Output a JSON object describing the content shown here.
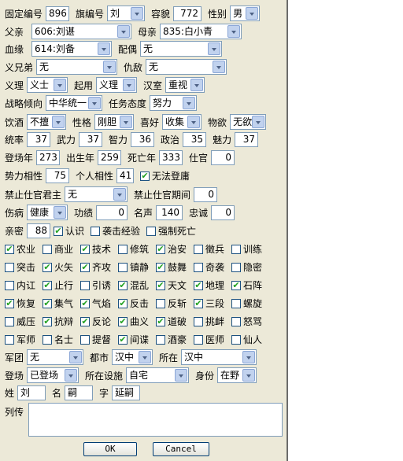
{
  "row1": {
    "fixed_id_label": "固定编号",
    "fixed_id": "896",
    "flag_label": "旗编号",
    "flag": "刘",
    "face_label": "容貌",
    "face": "772",
    "gender_label": "性别",
    "gender": "男"
  },
  "row2": {
    "father_label": "父亲",
    "father": "606:刘谌",
    "mother_label": "母亲",
    "mother": "835:白小青"
  },
  "row3": {
    "blood_label": "血缘",
    "blood": "614:刘备",
    "spouse_label": "配偶",
    "spouse": "无"
  },
  "row4": {
    "sworn_label": "义兄弟",
    "sworn": "无",
    "enemy_label": "仇敌",
    "enemy": "无"
  },
  "row5": {
    "righteous_label": "义理",
    "righteous": "义士",
    "employ_label": "起用",
    "employ": "义理",
    "han_label": "汉室",
    "han": "重视"
  },
  "row6": {
    "strategy_label": "战略倾向",
    "strategy": "中华统一",
    "mission_label": "任务态度",
    "mission": "努力"
  },
  "row7": {
    "drink_label": "饮酒",
    "drink": "不擅",
    "personality_label": "性格",
    "personality": "刚胆",
    "hobby_label": "喜好",
    "hobby": "收集",
    "desire_label": "物欲",
    "desire": "无欲"
  },
  "row8": {
    "lead_label": "统率",
    "lead": "37",
    "war_label": "武力",
    "war": "37",
    "int_label": "智力",
    "int": "36",
    "pol_label": "政治",
    "pol": "35",
    "cha_label": "魅力",
    "cha": "37"
  },
  "row9": {
    "debut_label": "登场年",
    "debut": "273",
    "birth_label": "出生年",
    "birth": "259",
    "death_label": "死亡年",
    "death": "333",
    "office_label": "仕官",
    "office": "0"
  },
  "row10": {
    "affinity_label": "势力相性",
    "affinity": "75",
    "personal_label": "个人相性",
    "personal": "41",
    "cannot_label": "无法登庸",
    "cannot_checked": true
  },
  "row11": {
    "ban_label": "禁止仕官君主",
    "ban": "无",
    "ban_period_label": "禁止仕官期间",
    "ban_period": "0"
  },
  "row12": {
    "injury_label": "伤病",
    "injury": "健康",
    "merit_label": "功绩",
    "merit": "0",
    "fame_label": "名声",
    "fame": "140",
    "loyal_label": "忠诚",
    "loyal": "0"
  },
  "row13": {
    "intimacy_label": "亲密",
    "intimacy": "88",
    "recognize_label": "认识",
    "recognize_checked": true,
    "exp_label": "袭击经验",
    "exp_checked": false,
    "force_label": "强制死亡",
    "force_checked": false
  },
  "skills": [
    [
      {
        "label": "农业",
        "checked": true
      },
      {
        "label": "商业",
        "checked": false
      },
      {
        "label": "技术",
        "checked": true
      },
      {
        "label": "修筑",
        "checked": false
      },
      {
        "label": "治安",
        "checked": true
      },
      {
        "label": "徵兵",
        "checked": false
      },
      {
        "label": "训练",
        "checked": false
      }
    ],
    [
      {
        "label": "突击",
        "checked": false
      },
      {
        "label": "火矢",
        "checked": true
      },
      {
        "label": "齐攻",
        "checked": true
      },
      {
        "label": "镇静",
        "checked": false
      },
      {
        "label": "鼓舞",
        "checked": true
      },
      {
        "label": "奇袭",
        "checked": false
      },
      {
        "label": "隐密",
        "checked": false
      }
    ],
    [
      {
        "label": "内讧",
        "checked": false
      },
      {
        "label": "止行",
        "checked": true
      },
      {
        "label": "引诱",
        "checked": false
      },
      {
        "label": "混乱",
        "checked": true
      },
      {
        "label": "天文",
        "checked": true
      },
      {
        "label": "地理",
        "checked": true
      },
      {
        "label": "石阵",
        "checked": true
      }
    ],
    [
      {
        "label": "恢复",
        "checked": true
      },
      {
        "label": "集气",
        "checked": true
      },
      {
        "label": "气焰",
        "checked": true
      },
      {
        "label": "反击",
        "checked": true
      },
      {
        "label": "反斩",
        "checked": false
      },
      {
        "label": "三段",
        "checked": true
      },
      {
        "label": "螺旋",
        "checked": false
      }
    ],
    [
      {
        "label": "威压",
        "checked": false
      },
      {
        "label": "抗辩",
        "checked": true
      },
      {
        "label": "反论",
        "checked": true
      },
      {
        "label": "曲义",
        "checked": true
      },
      {
        "label": "道破",
        "checked": true
      },
      {
        "label": "挑衅",
        "checked": false
      },
      {
        "label": "怒骂",
        "checked": false
      }
    ],
    [
      {
        "label": "军师",
        "checked": false
      },
      {
        "label": "名士",
        "checked": false
      },
      {
        "label": "提督",
        "checked": false
      },
      {
        "label": "间谍",
        "checked": true
      },
      {
        "label": "酒豪",
        "checked": false
      },
      {
        "label": "医师",
        "checked": false
      },
      {
        "label": "仙人",
        "checked": false
      }
    ]
  ],
  "row20": {
    "corps_label": "军团",
    "corps": "无",
    "city_label": "都市",
    "city": "汉中",
    "location_label": "所在",
    "location": "汉中"
  },
  "row21": {
    "appear_label": "登场",
    "appear": "已登场",
    "facility_label": "所在设施",
    "facility": "自宅",
    "status_label": "身份",
    "status": "在野"
  },
  "row22": {
    "surname_label": "姓",
    "surname": "刘",
    "given_label": "名",
    "given": "嗣",
    "style_label": "字",
    "style": "延嗣"
  },
  "bio_label": "列传",
  "ok_label": "OK",
  "cancel_label": "Cancel"
}
